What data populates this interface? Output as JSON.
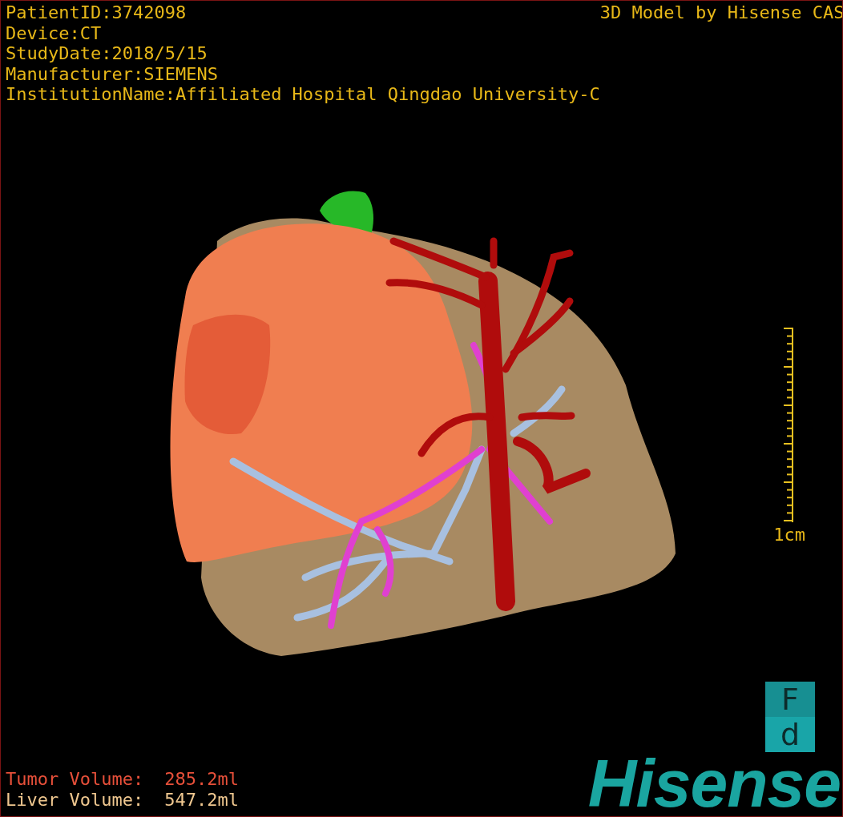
{
  "info": [
    "PatientID:3742098",
    "Device:CT",
    "StudyDate:2018/5/15",
    "Manufacturer:SIEMENS",
    "InstitutionName:Affiliated Hospital Qingdao University-C"
  ],
  "caption": "3D Model by Hisense CAS",
  "scale": {
    "label": "1cm"
  },
  "orientation_cube": {
    "top": "F",
    "bottom": "d"
  },
  "volumes": [
    {
      "kind": "tumor",
      "label": "Tumor Volume:",
      "value": "285.2ml"
    },
    {
      "kind": "liver",
      "label": "Liver Volume:",
      "value": "547.2ml"
    }
  ],
  "logo": "Hisense"
}
